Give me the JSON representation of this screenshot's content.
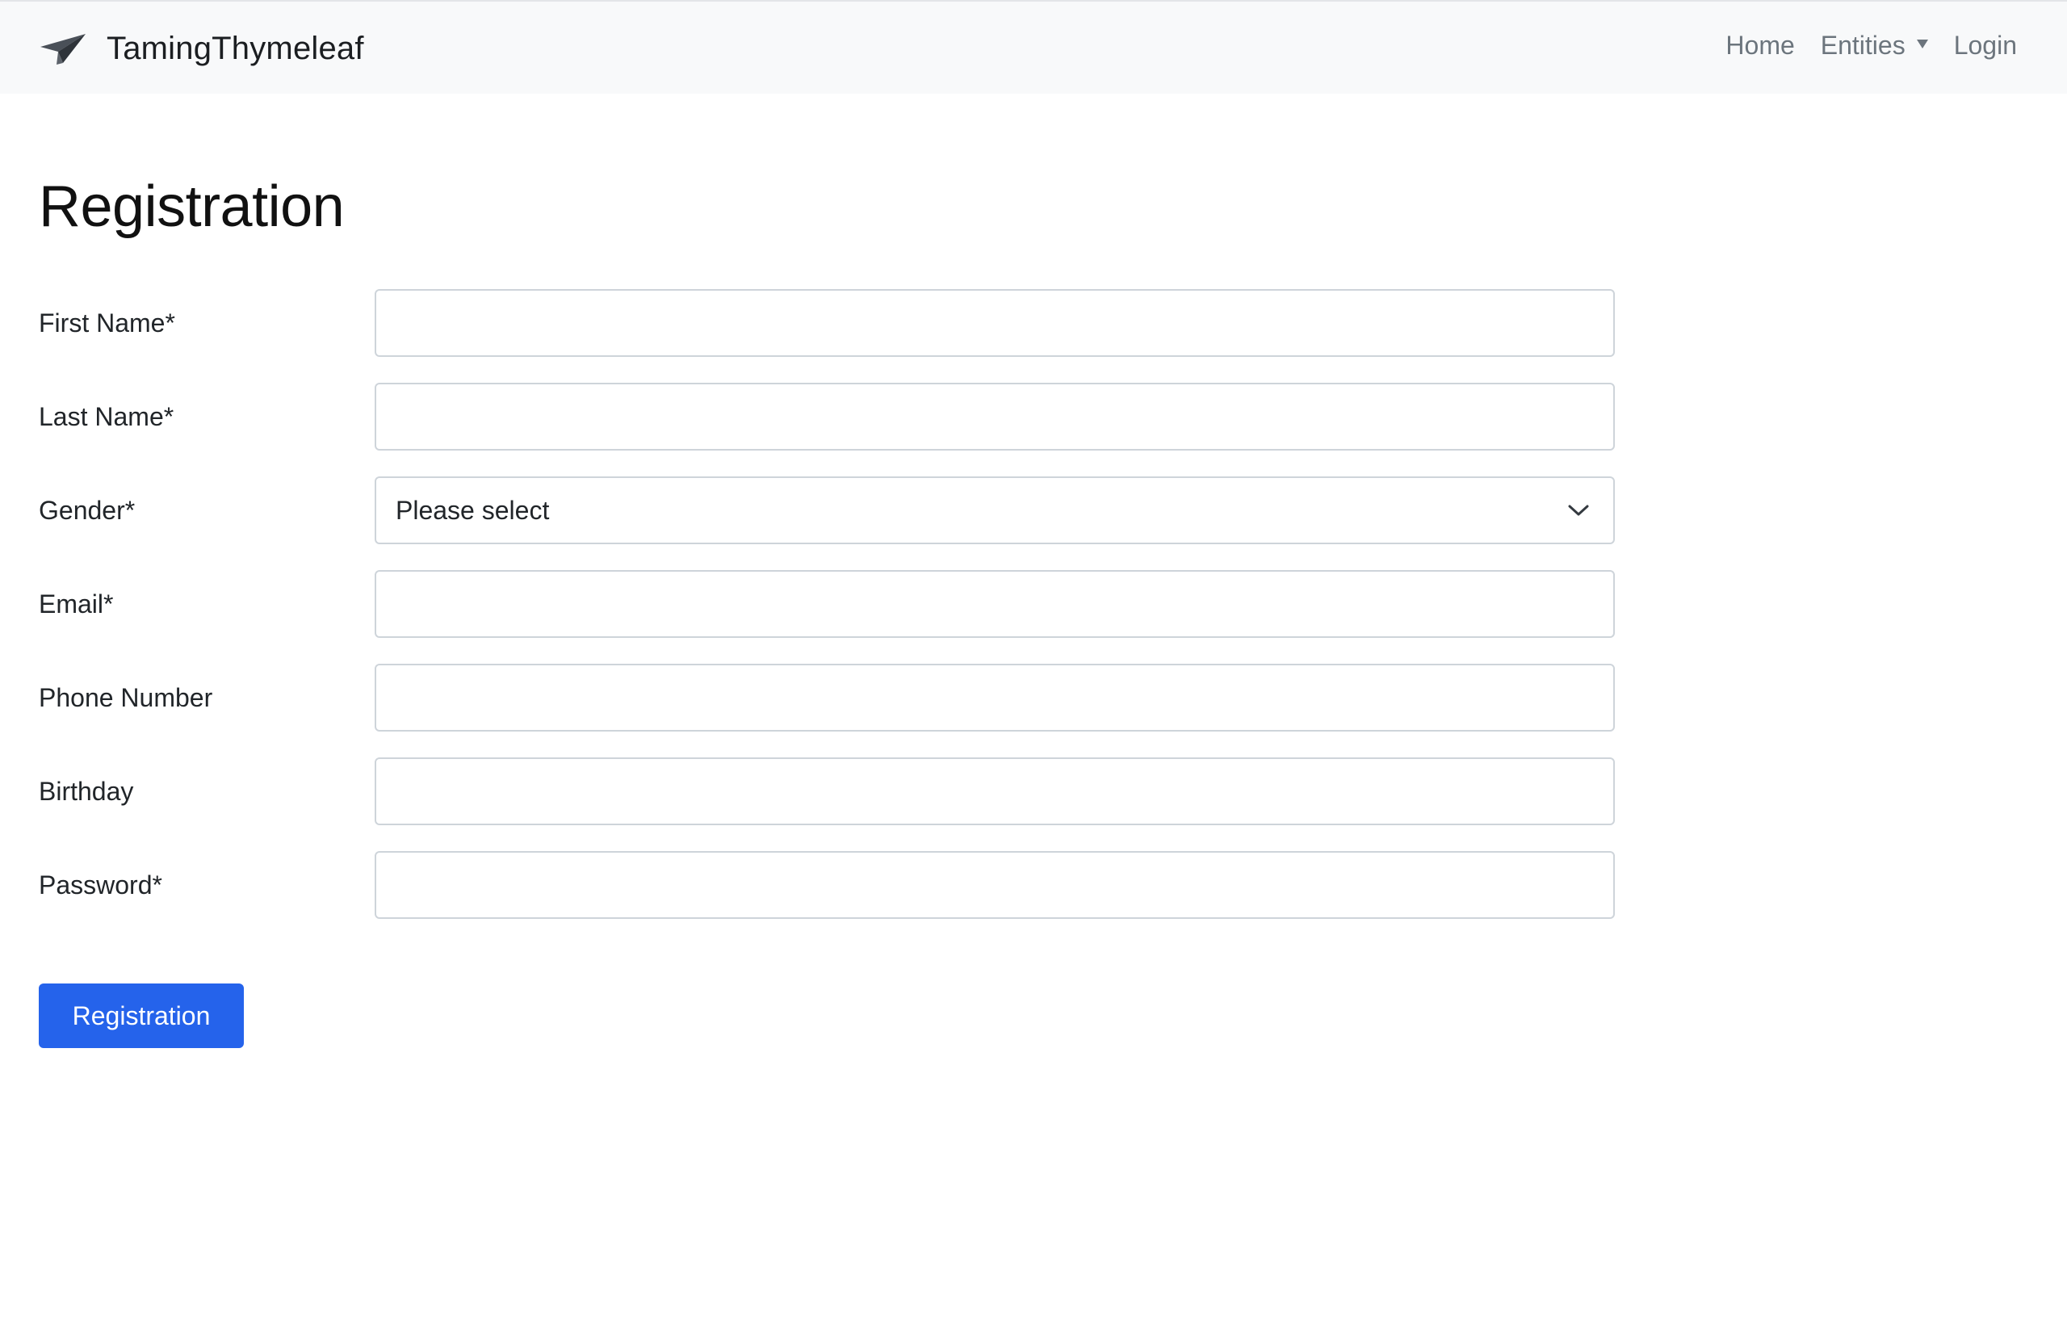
{
  "app": {
    "brand_name": "TamingThymeleaf",
    "brand_icon": "paper-plane-icon"
  },
  "nav": {
    "home": "Home",
    "entities": "Entities",
    "login": "Login"
  },
  "page": {
    "title": "Registration"
  },
  "form": {
    "fields": [
      {
        "label": "First Name*",
        "value": "",
        "type": "text"
      },
      {
        "label": "Last Name*",
        "value": "",
        "type": "text"
      },
      {
        "label": "Gender*",
        "value": "Please select",
        "type": "select"
      },
      {
        "label": "Email*",
        "value": "",
        "type": "email"
      },
      {
        "label": "Phone Number",
        "value": "",
        "type": "tel"
      },
      {
        "label": "Birthday",
        "value": "",
        "type": "text"
      },
      {
        "label": "Password*",
        "value": "",
        "type": "password"
      }
    ],
    "submit_label": "Registration"
  },
  "colors": {
    "primary": "#2563eb",
    "navbar_bg": "#f8f9fa",
    "nav_link": "#6c757d"
  }
}
